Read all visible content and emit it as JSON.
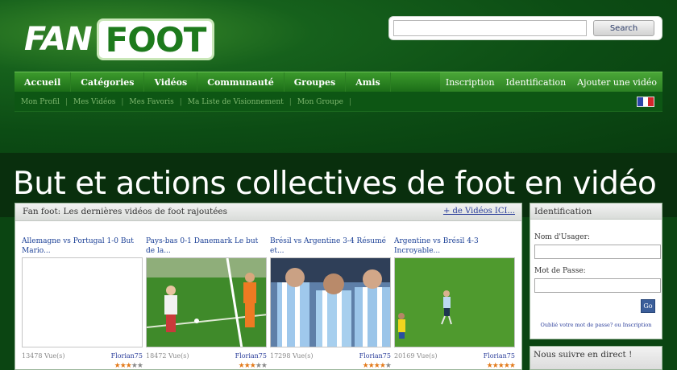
{
  "logo": {
    "part1": "FAN",
    "part2": "FOOT"
  },
  "search": {
    "button_label": "Search",
    "value": ""
  },
  "nav": {
    "left": [
      "Accueil",
      "Catégories",
      "Vidéos",
      "Communauté",
      "Groupes",
      "Amis"
    ],
    "right": [
      "Inscription",
      "Identification",
      "Ajouter une vidéo"
    ]
  },
  "subnav": [
    "Mon Profil",
    "Mes Vidéos",
    "Mes Favoris",
    "Ma Liste de Visionnement",
    "Mon Groupe"
  ],
  "hero": {
    "title": "But et actions collectives de foot en vidéo"
  },
  "main": {
    "title": "Fan foot: Les dernières vidéos de foot rajoutées",
    "more_link": "+ de Vidéos ICI...",
    "videos": [
      {
        "title": "Allemagne vs Portugal 1-0 But Mario...",
        "views": "13478 Vue(s)",
        "user": "Florian75",
        "rating": 3
      },
      {
        "title": "Pays-bas 0-1 Danemark Le but de la...",
        "views": "18472 Vue(s)",
        "user": "Florian75",
        "rating": 3
      },
      {
        "title": "Brésil vs Argentine 3-4 Résumé et...",
        "views": "17298 Vue(s)",
        "user": "Florian75",
        "rating": 4
      },
      {
        "title": "Argentine vs Brésil 4-3 Incroyable...",
        "views": "20169 Vue(s)",
        "user": "Florian75",
        "rating": 5
      }
    ]
  },
  "sidebar": {
    "title": "Identification",
    "username_label": "Nom d'Usager:",
    "password_label": "Mot de Passe:",
    "go_label": "Go",
    "forgot_text": "Oublié votre mot de passe? ou Inscription",
    "follow_title": "Nous suivre en direct !"
  }
}
